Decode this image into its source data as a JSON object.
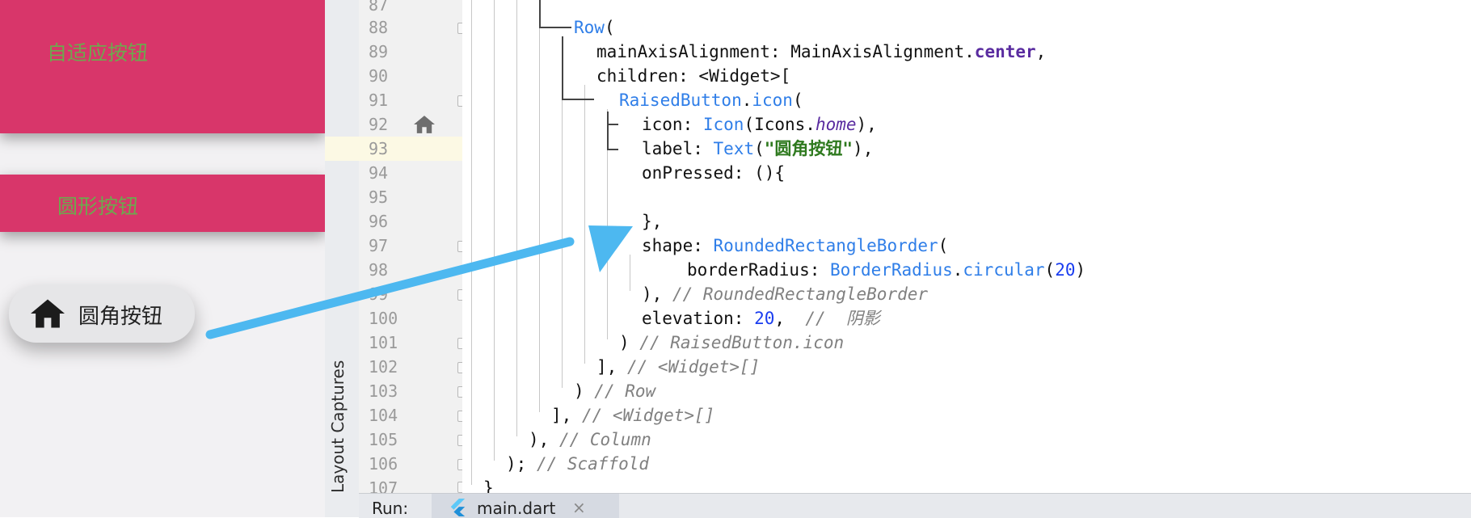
{
  "app": {
    "adaptive_button_label": "自适应按钮",
    "circle_button_label": "圆形按钮",
    "rounded_button_label": "圆角按钮",
    "button_color": "#d8366a",
    "label_color": "#6ea84e"
  },
  "ide": {
    "side_panel_title": "Layout Captures",
    "run_label": "Run:",
    "file_tab": "main.dart",
    "file_tab_close": "×",
    "current_line": 93,
    "lines": [
      {
        "n": "87"
      },
      {
        "n": "88"
      },
      {
        "n": "89"
      },
      {
        "n": "90"
      },
      {
        "n": "91"
      },
      {
        "n": "92"
      },
      {
        "n": "93"
      },
      {
        "n": "94"
      },
      {
        "n": "95"
      },
      {
        "n": "96"
      },
      {
        "n": "97"
      },
      {
        "n": "98"
      },
      {
        "n": "99"
      },
      {
        "n": "100"
      },
      {
        "n": "101"
      },
      {
        "n": "102"
      },
      {
        "n": "103"
      },
      {
        "n": "104"
      },
      {
        "n": "105"
      },
      {
        "n": "106"
      },
      {
        "n": "107"
      }
    ],
    "code": {
      "l88_row": "Row",
      "l88_p": "(",
      "l89_a": "mainAxisAlignment: MainAxisAlignment.",
      "l89_b": "center",
      "l89_c": ",",
      "l90": "children: <Widget>[",
      "l91_a": "RaisedButton",
      "l91_b": ".",
      "l91_c": "icon",
      "l91_d": "(",
      "l92_a": "icon: ",
      "l92_b": "Icon",
      "l92_c": "(Icons.",
      "l92_d": "home",
      "l92_e": "),",
      "l93_a": "label: ",
      "l93_b": "Text",
      "l93_c": "(",
      "l93_d": "\"圆角按钮\"",
      "l93_e": "),",
      "l94": "onPressed: (){",
      "l96": "},",
      "l97_a": "shape: ",
      "l97_b": "RoundedRectangleBorder",
      "l97_c": "(",
      "l98_a": "borderRadius: ",
      "l98_b": "BorderRadius",
      "l98_c": ".",
      "l98_d": "circular",
      "l98_e": "(",
      "l98_f": "20",
      "l98_g": ")",
      "l99_a": "), ",
      "l99_b": "// RoundedRectangleBorder",
      "l100_a": "elevation: ",
      "l100_b": "20",
      "l100_c": ",  ",
      "l100_d": "//  阴影",
      "l101_a": ") ",
      "l101_b": "// RaisedButton.icon",
      "l102_a": "], ",
      "l102_b": "// <Widget>[]",
      "l103_a": ") ",
      "l103_b": "// Row",
      "l104_a": "], ",
      "l104_b": "// <Widget>[]",
      "l105_a": "), ",
      "l105_b": "// Column",
      "l106_a": "); ",
      "l106_b": "// Scaffold",
      "l107": "}"
    }
  },
  "arrow_color": "#4db8f0"
}
